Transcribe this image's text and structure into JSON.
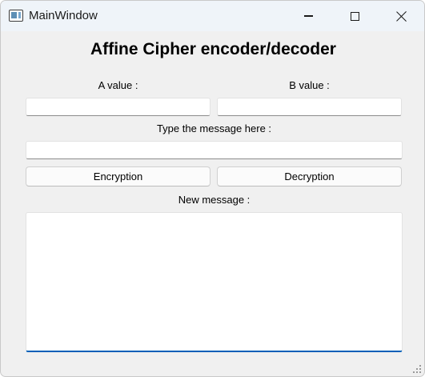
{
  "window": {
    "title": "MainWindow",
    "controls": {
      "minimize_icon": "minimize-icon",
      "maximize_icon": "maximize-icon",
      "close_icon": "close-icon"
    }
  },
  "main": {
    "heading": "Affine Cipher encoder/decoder",
    "a_value": {
      "label": "A value :",
      "value": ""
    },
    "b_value": {
      "label": "B value :",
      "value": ""
    },
    "message": {
      "label": "Type the message here :",
      "value": ""
    },
    "buttons": {
      "encryption": "Encryption",
      "decryption": "Decryption"
    },
    "output": {
      "label": "New message :",
      "value": ""
    }
  },
  "colors": {
    "titlebar_bg": "#eff4f9",
    "window_bg": "#f0f0f0",
    "focus_accent": "#005fb8"
  }
}
